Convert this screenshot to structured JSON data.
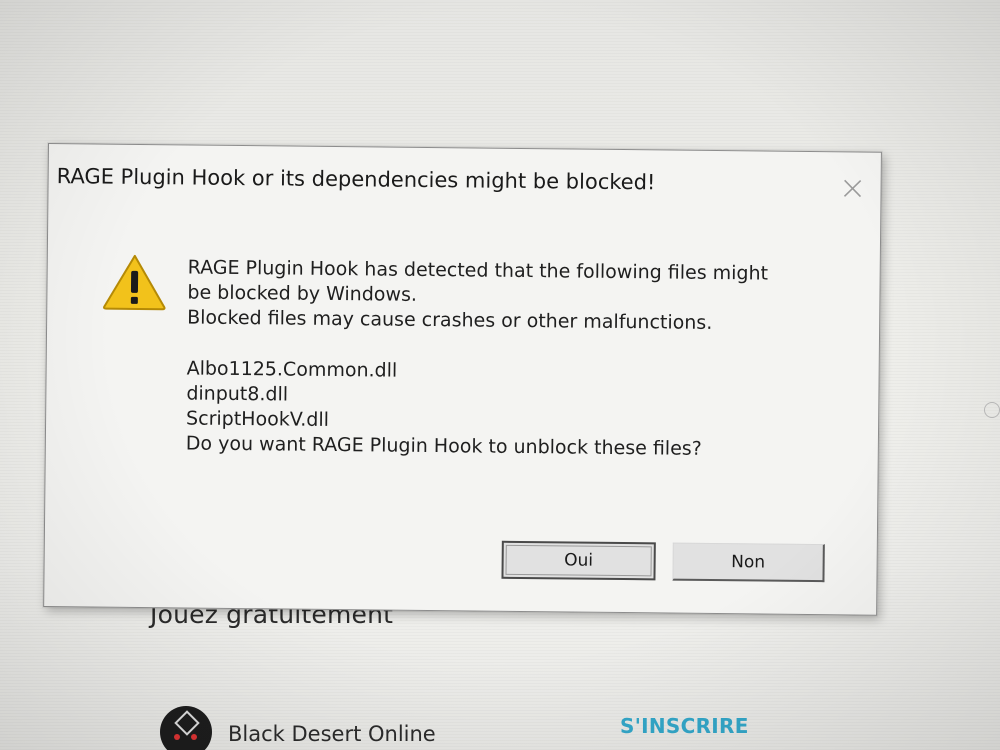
{
  "dialog": {
    "title": "RAGE Plugin Hook or its dependencies might be blocked!",
    "icon": "warning-icon",
    "message_line1": "RAGE Plugin Hook has detected that the following files might",
    "message_line2": "be blocked by Windows.",
    "message_line3": "Blocked files may cause crashes or other malfunctions.",
    "files": [
      "Albo1125.Common.dll",
      "dinput8.dll",
      "ScriptHookV.dll"
    ],
    "question": "Do you want RAGE Plugin Hook to unblock these files?",
    "buttons": {
      "yes": "Oui",
      "no": "Non"
    },
    "close_icon": "close-icon"
  },
  "background_page": {
    "heading": "Jouez gratuitement",
    "game": {
      "name": "Black Desert Online",
      "action": "S'INSCRIRE"
    }
  },
  "colors": {
    "link_accent": "#33a7c9",
    "warning_yellow": "#f2c21b"
  }
}
